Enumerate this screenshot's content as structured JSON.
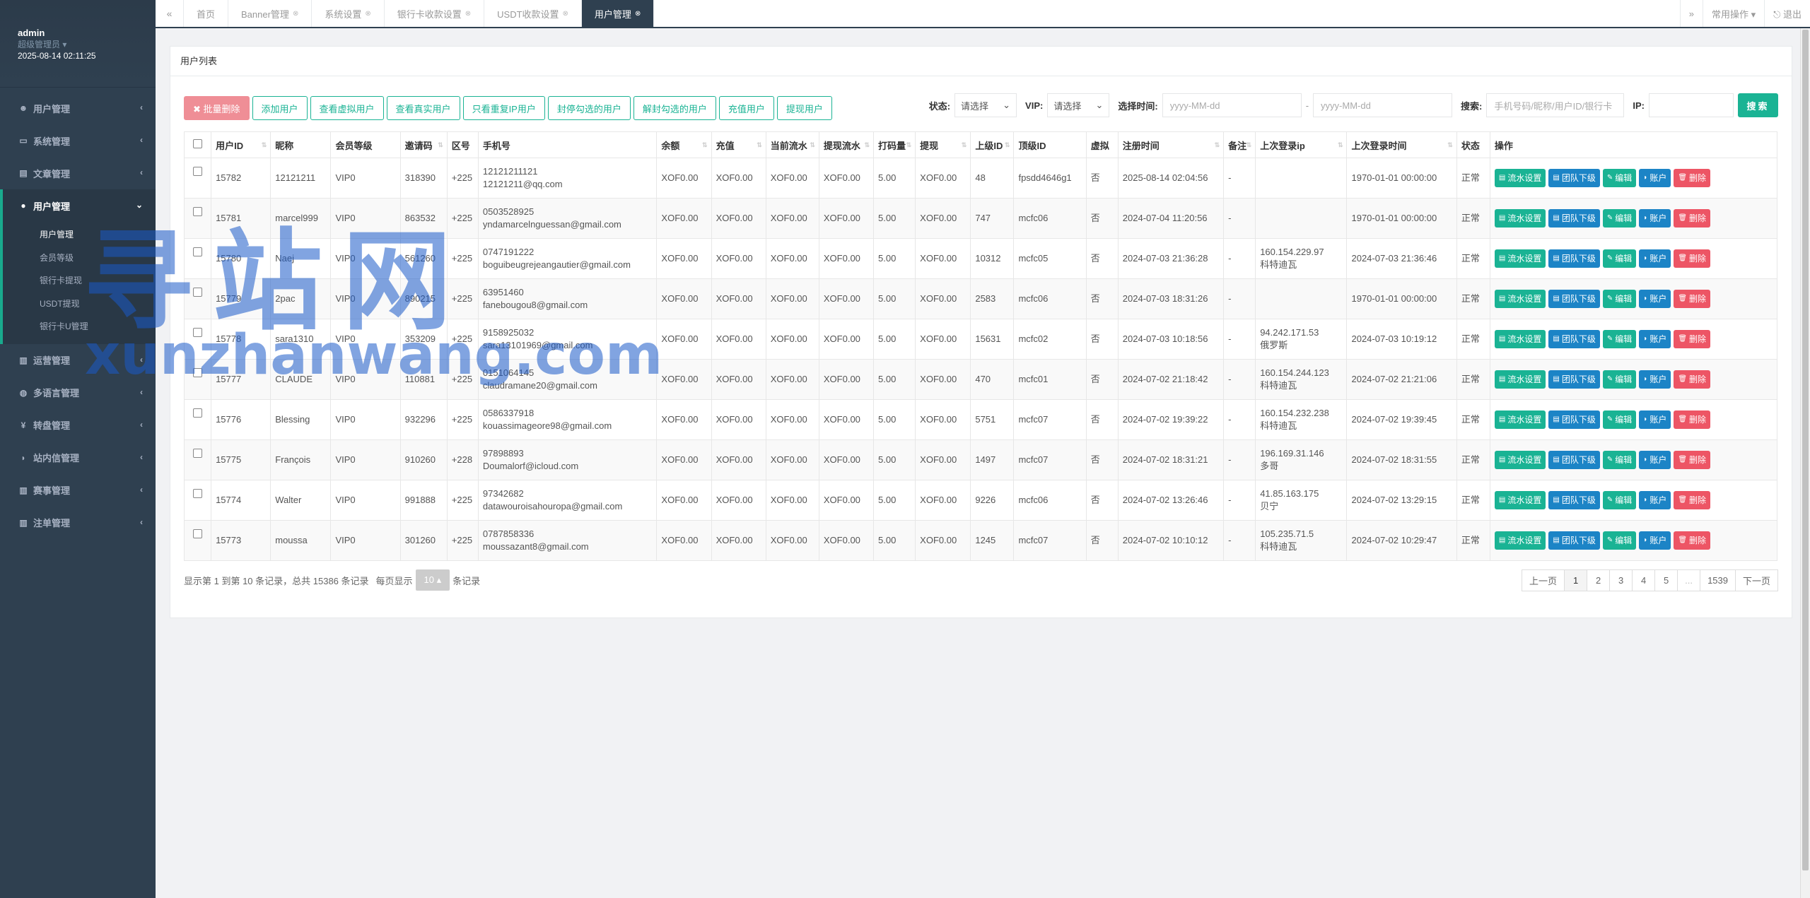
{
  "user": {
    "name": "admin",
    "role": "超级管理员 ▾",
    "time": "2025-08-14 02:11:25"
  },
  "nav": [
    {
      "label": "用户管理",
      "icon": "users-icon",
      "glyph": "☻"
    },
    {
      "label": "系统管理",
      "icon": "desktop-icon",
      "glyph": "▭"
    },
    {
      "label": "文章管理",
      "icon": "book-icon",
      "glyph": "▤"
    },
    {
      "label": "用户管理",
      "icon": "user-icon",
      "glyph": "●"
    },
    {
      "label": "运营管理",
      "icon": "bar-chart-icon",
      "glyph": "▥"
    },
    {
      "label": "多语言管理",
      "icon": "globe-icon",
      "glyph": "◍"
    },
    {
      "label": "转盘管理",
      "icon": "yen-icon",
      "glyph": "¥"
    },
    {
      "label": "站内信管理",
      "icon": "comment-icon",
      "glyph": "◗"
    },
    {
      "label": "赛事管理",
      "icon": "bar-chart-icon",
      "glyph": "▥"
    },
    {
      "label": "注单管理",
      "icon": "bar-chart-icon",
      "glyph": "▥"
    }
  ],
  "subnav": [
    "用户管理",
    "会员等级",
    "银行卡提现",
    "USDT提现",
    "银行卡U管理"
  ],
  "tabs": [
    "首页",
    "Banner管理",
    "系统设置",
    "银行卡收款设置",
    "USDT收款设置",
    "用户管理"
  ],
  "topbar": {
    "common_ops": "常用操作 ▾",
    "logout": "⎋ 退出"
  },
  "panel_title": "用户列表",
  "toolbar": [
    "✖ 批量删除",
    "添加用户",
    "查看虚拟用户",
    "查看真实用户",
    "只看重复IP用户",
    "封停勾选的用户",
    "解封勾选的用户",
    "充值用户",
    "提现用户"
  ],
  "filters": {
    "status_label": "状态:",
    "status_value": "请选择",
    "vip_label": "VIP:",
    "vip_value": "请选择",
    "time_label": "选择时间:",
    "date_placeholder_1": "yyyy-MM-dd",
    "date_sep": "-",
    "date_placeholder_2": "yyyy-MM-dd",
    "search_label": "搜索:",
    "search_placeholder": "手机号码/昵称/用户ID/银行卡",
    "ip_label": "IP:",
    "search_btn": "搜索"
  },
  "columns": [
    "用户ID",
    "昵称",
    "会员等级",
    "邀请码",
    "区号",
    "手机号",
    "余额",
    "充值",
    "当前流水",
    "提现流水",
    "打码量",
    "提现",
    "上级ID",
    "顶级ID",
    "虚拟",
    "注册时间",
    "备注",
    "上次登录ip",
    "上次登录时间",
    "状态",
    "操作"
  ],
  "actions": [
    "流水设置",
    "团队下级",
    "编辑",
    "账户",
    "删除"
  ],
  "rows": [
    {
      "id": "15782",
      "nick": "12121211",
      "vip": "VIP0",
      "invite": "318390",
      "code": "+225",
      "phone": "12121211121",
      "email": "12121211@qq.com",
      "balance": "XOF0.00",
      "recharge": "XOF0.00",
      "flow": "XOF0.00",
      "wflow": "XOF0.00",
      "bet": "5.00",
      "withdraw": "XOF0.00",
      "parent": "48",
      "top": "fpsdd4646g1",
      "virtual": "否",
      "reg": "2025-08-14 02:04:56",
      "note": "-",
      "ip": "",
      "ipLoc": "",
      "last": "1970-01-01 00:00:00",
      "status": "正常"
    },
    {
      "id": "15781",
      "nick": "marcel999",
      "vip": "VIP0",
      "invite": "863532",
      "code": "+225",
      "phone": "0503528925",
      "email": "yndamarcelnguessan@gmail.com",
      "balance": "XOF0.00",
      "recharge": "XOF0.00",
      "flow": "XOF0.00",
      "wflow": "XOF0.00",
      "bet": "5.00",
      "withdraw": "XOF0.00",
      "parent": "747",
      "top": "mcfc06",
      "virtual": "否",
      "reg": "2024-07-04 11:20:56",
      "note": "-",
      "ip": "",
      "ipLoc": "",
      "last": "1970-01-01 00:00:00",
      "status": "正常"
    },
    {
      "id": "15780",
      "nick": "Naej",
      "vip": "VIP0",
      "invite": "561260",
      "code": "+225",
      "phone": "0747191222",
      "email": "boguibeugrejeangautier@gmail.com",
      "balance": "XOF0.00",
      "recharge": "XOF0.00",
      "flow": "XOF0.00",
      "wflow": "XOF0.00",
      "bet": "5.00",
      "withdraw": "XOF0.00",
      "parent": "10312",
      "top": "mcfc05",
      "virtual": "否",
      "reg": "2024-07-03 21:36:28",
      "note": "-",
      "ip": "160.154.229.97",
      "ipLoc": "科特迪瓦",
      "last": "2024-07-03 21:36:46",
      "status": "正常"
    },
    {
      "id": "15779",
      "nick": "2pac",
      "vip": "VIP0",
      "invite": "890215",
      "code": "+225",
      "phone": "63951460",
      "email": "fanebougou8@gmail.com",
      "balance": "XOF0.00",
      "recharge": "XOF0.00",
      "flow": "XOF0.00",
      "wflow": "XOF0.00",
      "bet": "5.00",
      "withdraw": "XOF0.00",
      "parent": "2583",
      "top": "mcfc06",
      "virtual": "否",
      "reg": "2024-07-03 18:31:26",
      "note": "-",
      "ip": "",
      "ipLoc": "",
      "last": "1970-01-01 00:00:00",
      "status": "正常"
    },
    {
      "id": "15778",
      "nick": "sara1310",
      "vip": "VIP0",
      "invite": "353209",
      "code": "+225",
      "phone": "9158925032",
      "email": "sara13101969@gmail.com",
      "balance": "XOF0.00",
      "recharge": "XOF0.00",
      "flow": "XOF0.00",
      "wflow": "XOF0.00",
      "bet": "5.00",
      "withdraw": "XOF0.00",
      "parent": "15631",
      "top": "mcfc02",
      "virtual": "否",
      "reg": "2024-07-03 10:18:56",
      "note": "-",
      "ip": "94.242.171.53",
      "ipLoc": "俄罗斯",
      "last": "2024-07-03 10:19:12",
      "status": "正常"
    },
    {
      "id": "15777",
      "nick": "CLAUDE",
      "vip": "VIP0",
      "invite": "110881",
      "code": "+225",
      "phone": "0151064145",
      "email": "claudramane20@gmail.com",
      "balance": "XOF0.00",
      "recharge": "XOF0.00",
      "flow": "XOF0.00",
      "wflow": "XOF0.00",
      "bet": "5.00",
      "withdraw": "XOF0.00",
      "parent": "470",
      "top": "mcfc01",
      "virtual": "否",
      "reg": "2024-07-02 21:18:42",
      "note": "-",
      "ip": "160.154.244.123",
      "ipLoc": "科特迪瓦",
      "last": "2024-07-02 21:21:06",
      "status": "正常"
    },
    {
      "id": "15776",
      "nick": "Blessing",
      "vip": "VIP0",
      "invite": "932296",
      "code": "+225",
      "phone": "0586337918",
      "email": "kouassimageore98@gmail.com",
      "balance": "XOF0.00",
      "recharge": "XOF0.00",
      "flow": "XOF0.00",
      "wflow": "XOF0.00",
      "bet": "5.00",
      "withdraw": "XOF0.00",
      "parent": "5751",
      "top": "mcfc07",
      "virtual": "否",
      "reg": "2024-07-02 19:39:22",
      "note": "-",
      "ip": "160.154.232.238",
      "ipLoc": "科特迪瓦",
      "last": "2024-07-02 19:39:45",
      "status": "正常"
    },
    {
      "id": "15775",
      "nick": "François",
      "vip": "VIP0",
      "invite": "910260",
      "code": "+228",
      "phone": "97898893",
      "email": "Doumalorf@icloud.com",
      "balance": "XOF0.00",
      "recharge": "XOF0.00",
      "flow": "XOF0.00",
      "wflow": "XOF0.00",
      "bet": "5.00",
      "withdraw": "XOF0.00",
      "parent": "1497",
      "top": "mcfc07",
      "virtual": "否",
      "reg": "2024-07-02 18:31:21",
      "note": "-",
      "ip": "196.169.31.146",
      "ipLoc": "多哥",
      "last": "2024-07-02 18:31:55",
      "status": "正常"
    },
    {
      "id": "15774",
      "nick": "Walter",
      "vip": "VIP0",
      "invite": "991888",
      "code": "+225",
      "phone": "97342682",
      "email": "datawouroisahouropa@gmail.com",
      "balance": "XOF0.00",
      "recharge": "XOF0.00",
      "flow": "XOF0.00",
      "wflow": "XOF0.00",
      "bet": "5.00",
      "withdraw": "XOF0.00",
      "parent": "9226",
      "top": "mcfc06",
      "virtual": "否",
      "reg": "2024-07-02 13:26:46",
      "note": "-",
      "ip": "41.85.163.175",
      "ipLoc": "贝宁",
      "last": "2024-07-02 13:29:15",
      "status": "正常"
    },
    {
      "id": "15773",
      "nick": "moussa",
      "vip": "VIP0",
      "invite": "301260",
      "code": "+225",
      "phone": "0787858336",
      "email": "moussazant8@gmail.com",
      "balance": "XOF0.00",
      "recharge": "XOF0.00",
      "flow": "XOF0.00",
      "wflow": "XOF0.00",
      "bet": "5.00",
      "withdraw": "XOF0.00",
      "parent": "1245",
      "top": "mcfc07",
      "virtual": "否",
      "reg": "2024-07-02 10:10:12",
      "note": "-",
      "ip": "105.235.71.5",
      "ipLoc": "科特迪瓦",
      "last": "2024-07-02 10:29:47",
      "status": "正常"
    }
  ],
  "footer": {
    "info": "显示第 1 到第 10 条记录，总共 15386 条记录",
    "per_page_label": "每页显示",
    "per_page": "10 ▴",
    "per_page_suffix": "条记录"
  },
  "pagination": [
    "上一页",
    "1",
    "2",
    "3",
    "4",
    "5",
    "...",
    "1539",
    "下一页"
  ],
  "watermark": {
    "line1": "寻站网",
    "line2": "xunzhanwang.com"
  },
  "colors": {
    "sidebar": "#2f4050",
    "accent": "#1ab394",
    "primary": "#1c84c6",
    "danger": "#ed5565"
  }
}
